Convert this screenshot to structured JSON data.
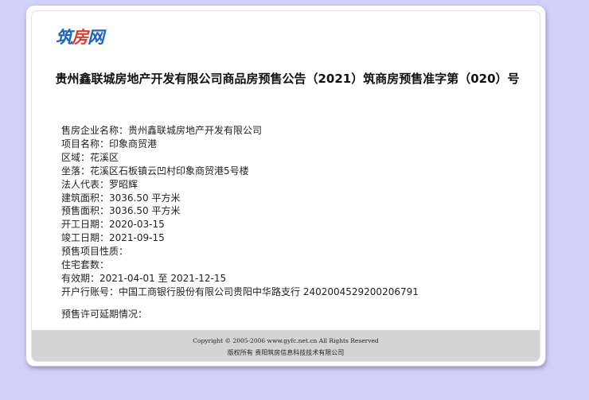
{
  "logo": {
    "part1": "筑",
    "part2": "房",
    "part3": "网"
  },
  "title": "贵州鑫联城房地产开发有限公司商品房预售公告（2021）筑商房预售准字第（020）号",
  "info": [
    "售房企业名称：贵州鑫联城房地产开发有限公司",
    "项目名称：印象商贸港",
    "区域：花溪区",
    "坐落：花溪区石板镇云凹村印象商贸港5号楼",
    "法人代表：罗昭辉",
    "建筑面积：3036.50 平方米",
    "预售面积：3036.50 平方米",
    "开工日期：2020-03-15",
    "竣工日期：2021-09-15",
    "预售项目性质：",
    "住宅套数：",
    "有效期：2021-04-01 至 2021-12-15",
    "开户行账号：中国工商银行股份有限公司贵阳中华路支行 2402004529200206791"
  ],
  "extension_label": "预售许可延期情况：",
  "footer": {
    "copyright": "Copyright © 2005-2006 www.gyfc.net.cn All Rights Reserved",
    "rights": "版权所有 贵阳筑房信息科技技术有限公司"
  }
}
